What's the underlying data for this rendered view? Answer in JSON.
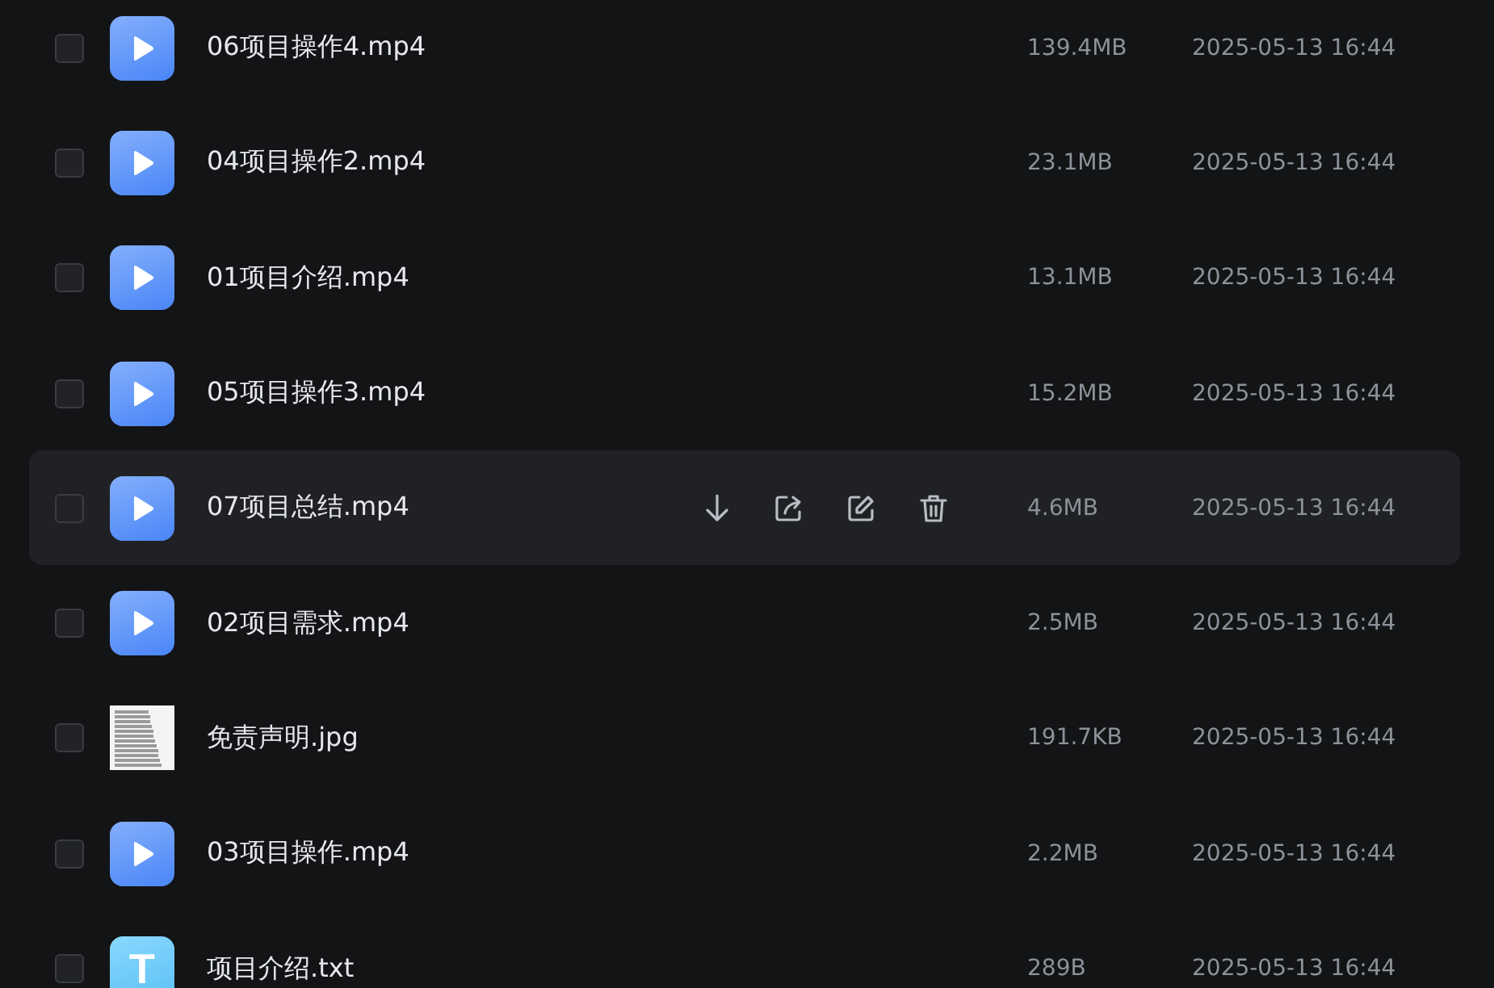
{
  "files": [
    {
      "kind": "video",
      "name": "06项目操作4.mp4",
      "size": "139.4MB",
      "date": "2025-05-13 16:44",
      "checked": false,
      "hovered": false
    },
    {
      "kind": "video",
      "name": "04项目操作2.mp4",
      "size": "23.1MB",
      "date": "2025-05-13 16:44",
      "checked": false,
      "hovered": false
    },
    {
      "kind": "video",
      "name": "01项目介绍.mp4",
      "size": "13.1MB",
      "date": "2025-05-13 16:44",
      "checked": false,
      "hovered": false
    },
    {
      "kind": "video",
      "name": "05项目操作3.mp4",
      "size": "15.2MB",
      "date": "2025-05-13 16:44",
      "checked": false,
      "hovered": false
    },
    {
      "kind": "video",
      "name": "07项目总结.mp4",
      "size": "4.6MB",
      "date": "2025-05-13 16:44",
      "checked": false,
      "hovered": true
    },
    {
      "kind": "video",
      "name": "02项目需求.mp4",
      "size": "2.5MB",
      "date": "2025-05-13 16:44",
      "checked": false,
      "hovered": false
    },
    {
      "kind": "image",
      "name": "免责声明.jpg",
      "size": "191.7KB",
      "date": "2025-05-13 16:44",
      "checked": false,
      "hovered": false
    },
    {
      "kind": "video",
      "name": "03项目操作.mp4",
      "size": "2.2MB",
      "date": "2025-05-13 16:44",
      "checked": false,
      "hovered": false
    },
    {
      "kind": "text",
      "icon_letter": "T",
      "name": "项目介绍.txt",
      "size": "289B",
      "date": "2025-05-13 16:44",
      "checked": false,
      "hovered": false
    }
  ]
}
